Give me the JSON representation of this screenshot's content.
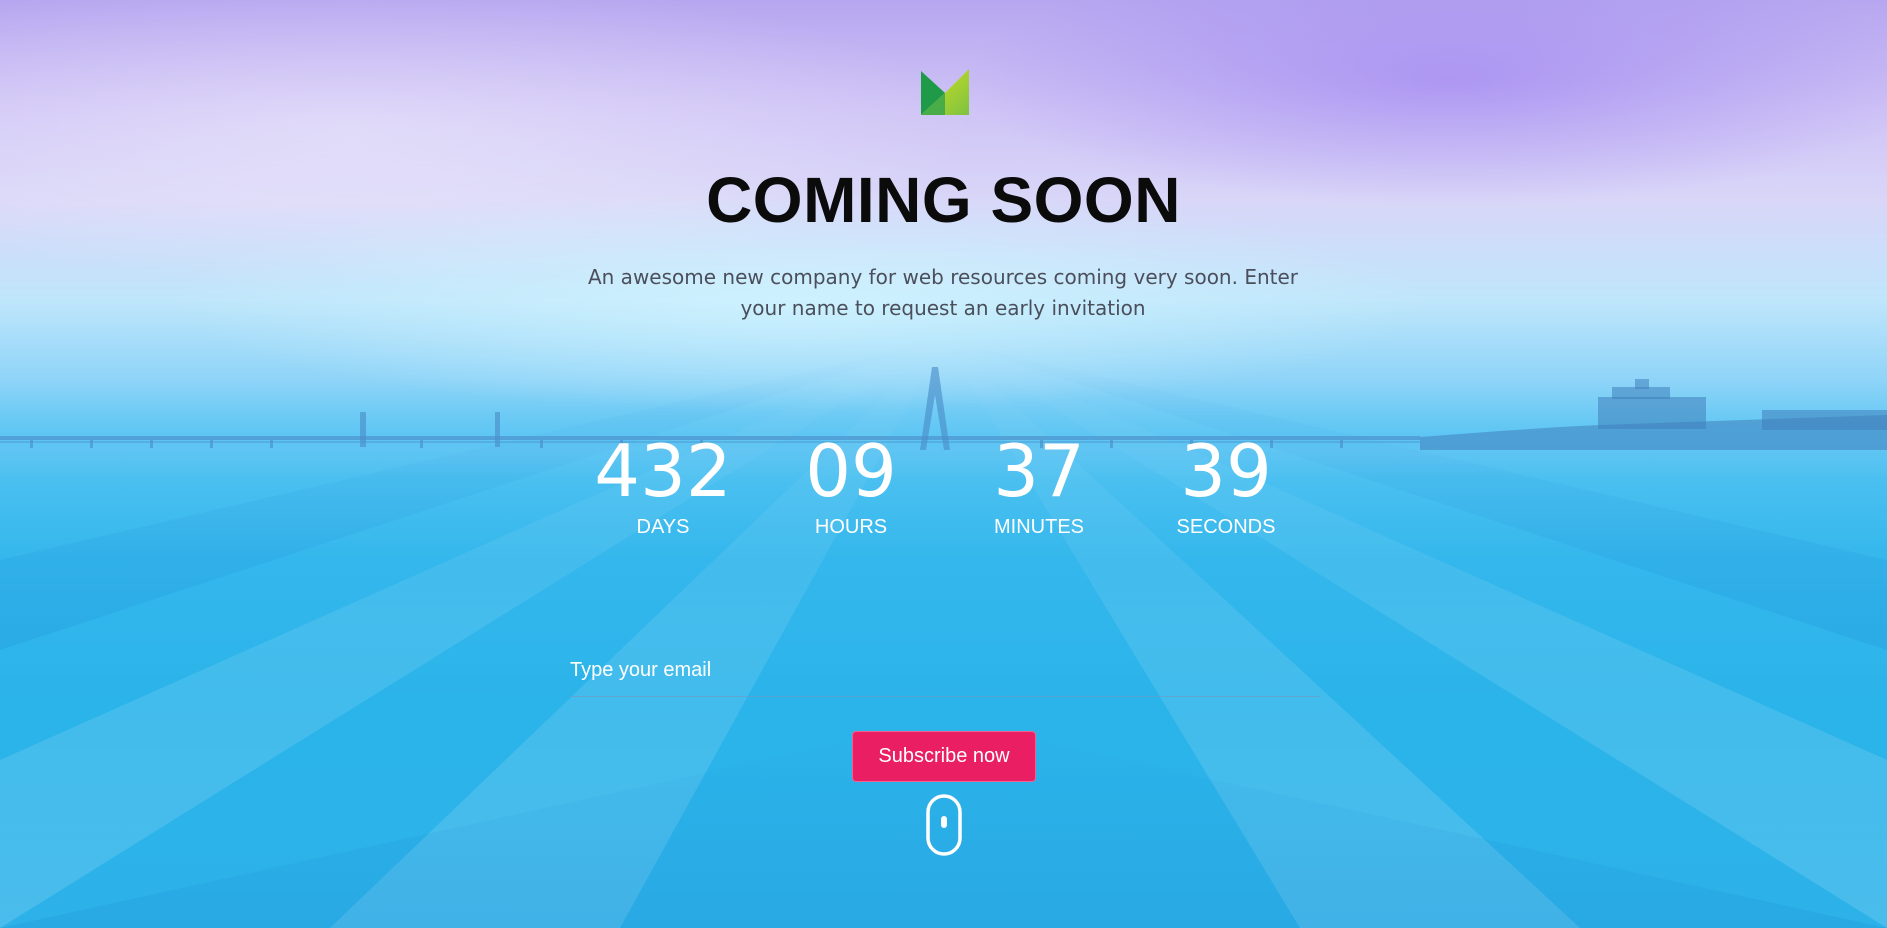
{
  "page": {
    "title": "COMING SOON",
    "subtitle": "An awesome new company for web resources coming very soon. Enter your name to request an early invitation"
  },
  "logo": {
    "icon": "m-logo-icon",
    "colors": [
      "#1f9a48",
      "#7cc242",
      "#d8e21b"
    ]
  },
  "countdown": {
    "days": {
      "value": "432",
      "label": "DAYS"
    },
    "hours": {
      "value": "09",
      "label": "HOURS"
    },
    "minutes": {
      "value": "37",
      "label": "MINUTES"
    },
    "seconds": {
      "value": "39",
      "label": "SECONDS"
    }
  },
  "subscribe": {
    "email_placeholder": "Type your email",
    "email_value": "",
    "button_label": "Subscribe now"
  },
  "scroll_indicator": {
    "icon": "mouse-scroll-icon"
  },
  "colors": {
    "accent": "#e91e63",
    "title": "#0b0b0b",
    "subtitle": "#4b4f5c",
    "countdown": "#ffffff"
  }
}
